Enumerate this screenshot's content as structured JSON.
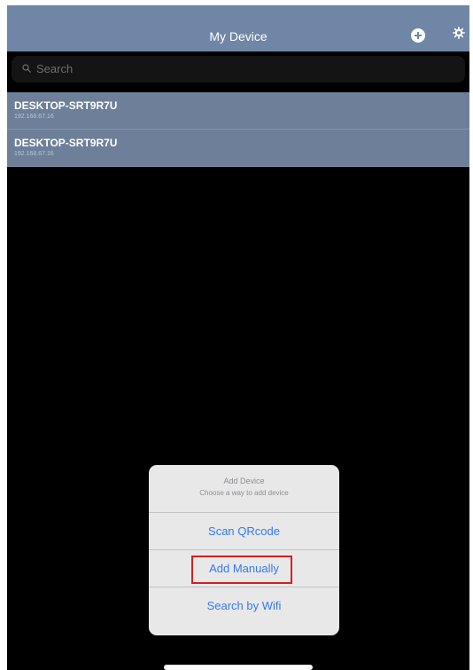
{
  "navbar": {
    "title": "My Device",
    "add_icon": "plus-circle-icon",
    "settings_icon": "gear-icon"
  },
  "search": {
    "placeholder": "Search",
    "icon": "search-icon"
  },
  "devices": [
    {
      "name": "DESKTOP-SRT9R7U",
      "ip": "192.168.67.16"
    },
    {
      "name": "DESKTOP-SRT9R7U",
      "ip": "192.168.67.16"
    }
  ],
  "action_sheet": {
    "title": "Add Device",
    "subtitle": "Choose a way to add device",
    "options": [
      {
        "label": "Scan QRcode"
      },
      {
        "label": "Add Manually",
        "highlighted": true
      },
      {
        "label": "Search by Wifi"
      }
    ]
  },
  "colors": {
    "navbar_bg": "#6f86a6",
    "row_bg": "#6d7f99",
    "action_blue": "#3478f6",
    "highlight_red": "#d91e1e"
  }
}
